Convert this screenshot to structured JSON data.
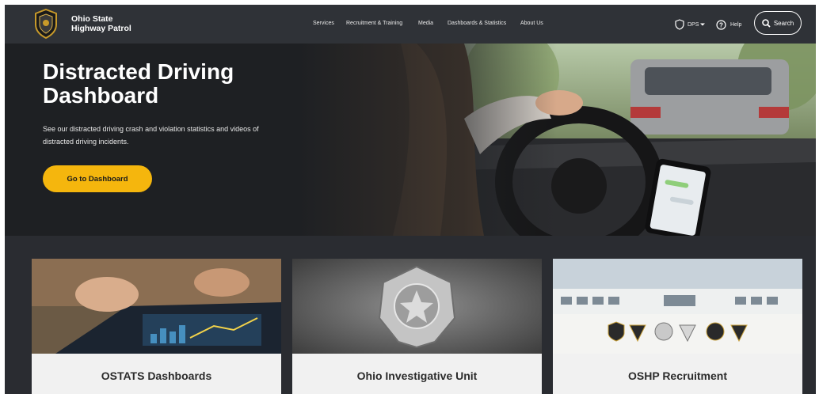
{
  "header": {
    "brand_line1": "Ohio State",
    "brand_line2": "Highway Patrol",
    "nav": [
      "Services",
      "Recruitment & Training",
      "Media",
      "Dashboards & Statistics",
      "About Us"
    ],
    "dps_label": "DPS",
    "help_label": "Help",
    "search_label": "Search"
  },
  "hero": {
    "title": "Distracted Driving Dashboard",
    "description": "See our distracted driving crash and violation statistics and videos of distracted driving incidents.",
    "button_label": "Go to Dashboard"
  },
  "cards": [
    {
      "title": "OSTATS Dashboards"
    },
    {
      "title": "Ohio Investigative Unit"
    },
    {
      "title": "OSHP Recruitment"
    }
  ],
  "colors": {
    "header_bg": "#2f3237",
    "hero_bg": "#1e2023",
    "accent": "#f5b60d",
    "card_bg": "#f1f1f1"
  },
  "icons": [
    "shield-logo-icon",
    "shield-outline-icon",
    "help-circle-icon",
    "search-icon",
    "caret-down-icon"
  ]
}
